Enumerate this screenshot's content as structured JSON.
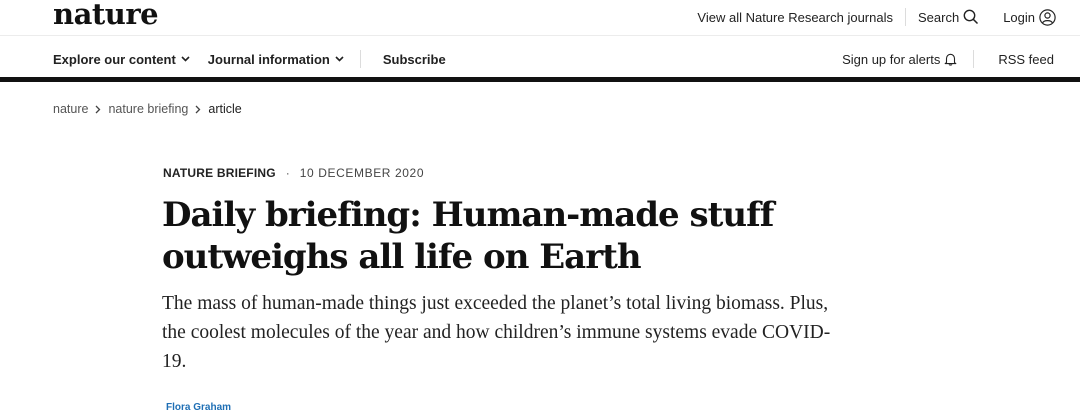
{
  "header": {
    "logo": "nature",
    "links": {
      "journals": "View all Nature Research journals",
      "search": "Search",
      "login": "Login"
    }
  },
  "nav": {
    "explore": "Explore our content",
    "journal_info": "Journal information",
    "subscribe": "Subscribe",
    "alerts": "Sign up for alerts",
    "rss": "RSS feed"
  },
  "breadcrumb": [
    "nature",
    "nature briefing",
    "article"
  ],
  "article": {
    "type": "NATURE BRIEFING",
    "separator": "·",
    "date": "10 DECEMBER 2020",
    "title_line1": "Daily briefing: Human-made stuff",
    "title_line2": "outweighs all life on Earth",
    "standfirst": "The mass of human-made things just exceeded the planet’s total living biomass. Plus, the coolest molecules of the year and how children’s immune systems evade COVID-19.",
    "author": "Flora Graham"
  },
  "icons": {
    "search": "search-icon",
    "login": "user-circle-icon",
    "alerts": "bell-icon",
    "chevron": "chevron-down-icon",
    "breadcrumb_sep": "chevron-right-icon"
  }
}
